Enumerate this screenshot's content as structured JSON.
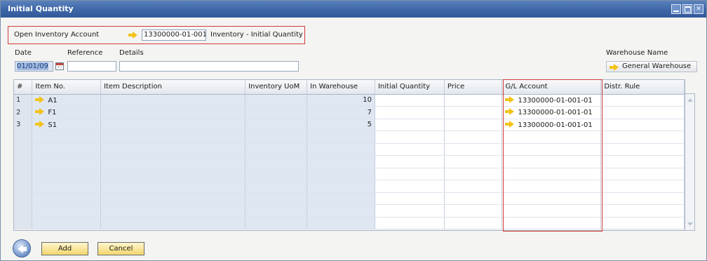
{
  "window": {
    "title": "Initial Quantity"
  },
  "header": {
    "account_label": "Open Inventory Account",
    "account_value": "13300000-01-001-",
    "account_description": "Inventory - Initial Quantity",
    "date_label": "Date",
    "reference_label": "Reference",
    "details_label": "Details",
    "date_value": "01/01/09",
    "reference_value": "",
    "details_value": "",
    "warehouse_label": "Warehouse Name",
    "warehouse_value": "General Warehouse"
  },
  "grid": {
    "columns": [
      "#",
      "Item No.",
      "Item Description",
      "Inventory UoM",
      "In Warehouse",
      "Initial Quantity",
      "Price",
      "G/L Account",
      "Distr. Rule"
    ],
    "rows": [
      {
        "num": "1",
        "item_no": "A1",
        "description": "",
        "uom": "",
        "in_warehouse": "10",
        "initial_qty": "",
        "price": "",
        "gl_account": "13300000-01-001-01",
        "distr_rule": ""
      },
      {
        "num": "2",
        "item_no": "F1",
        "description": "",
        "uom": "",
        "in_warehouse": "7",
        "initial_qty": "",
        "price": "",
        "gl_account": "13300000-01-001-01",
        "distr_rule": ""
      },
      {
        "num": "3",
        "item_no": "S1",
        "description": "",
        "uom": "",
        "in_warehouse": "5",
        "initial_qty": "",
        "price": "",
        "gl_account": "13300000-01-001-01",
        "distr_rule": ""
      }
    ]
  },
  "footer": {
    "add_label": "Add",
    "cancel_label": "Cancel"
  },
  "colors": {
    "title_bar": "#3d66a6",
    "highlight": "#d33a3a",
    "link_arrow": "#f2c218",
    "button": "#f3d66d"
  }
}
